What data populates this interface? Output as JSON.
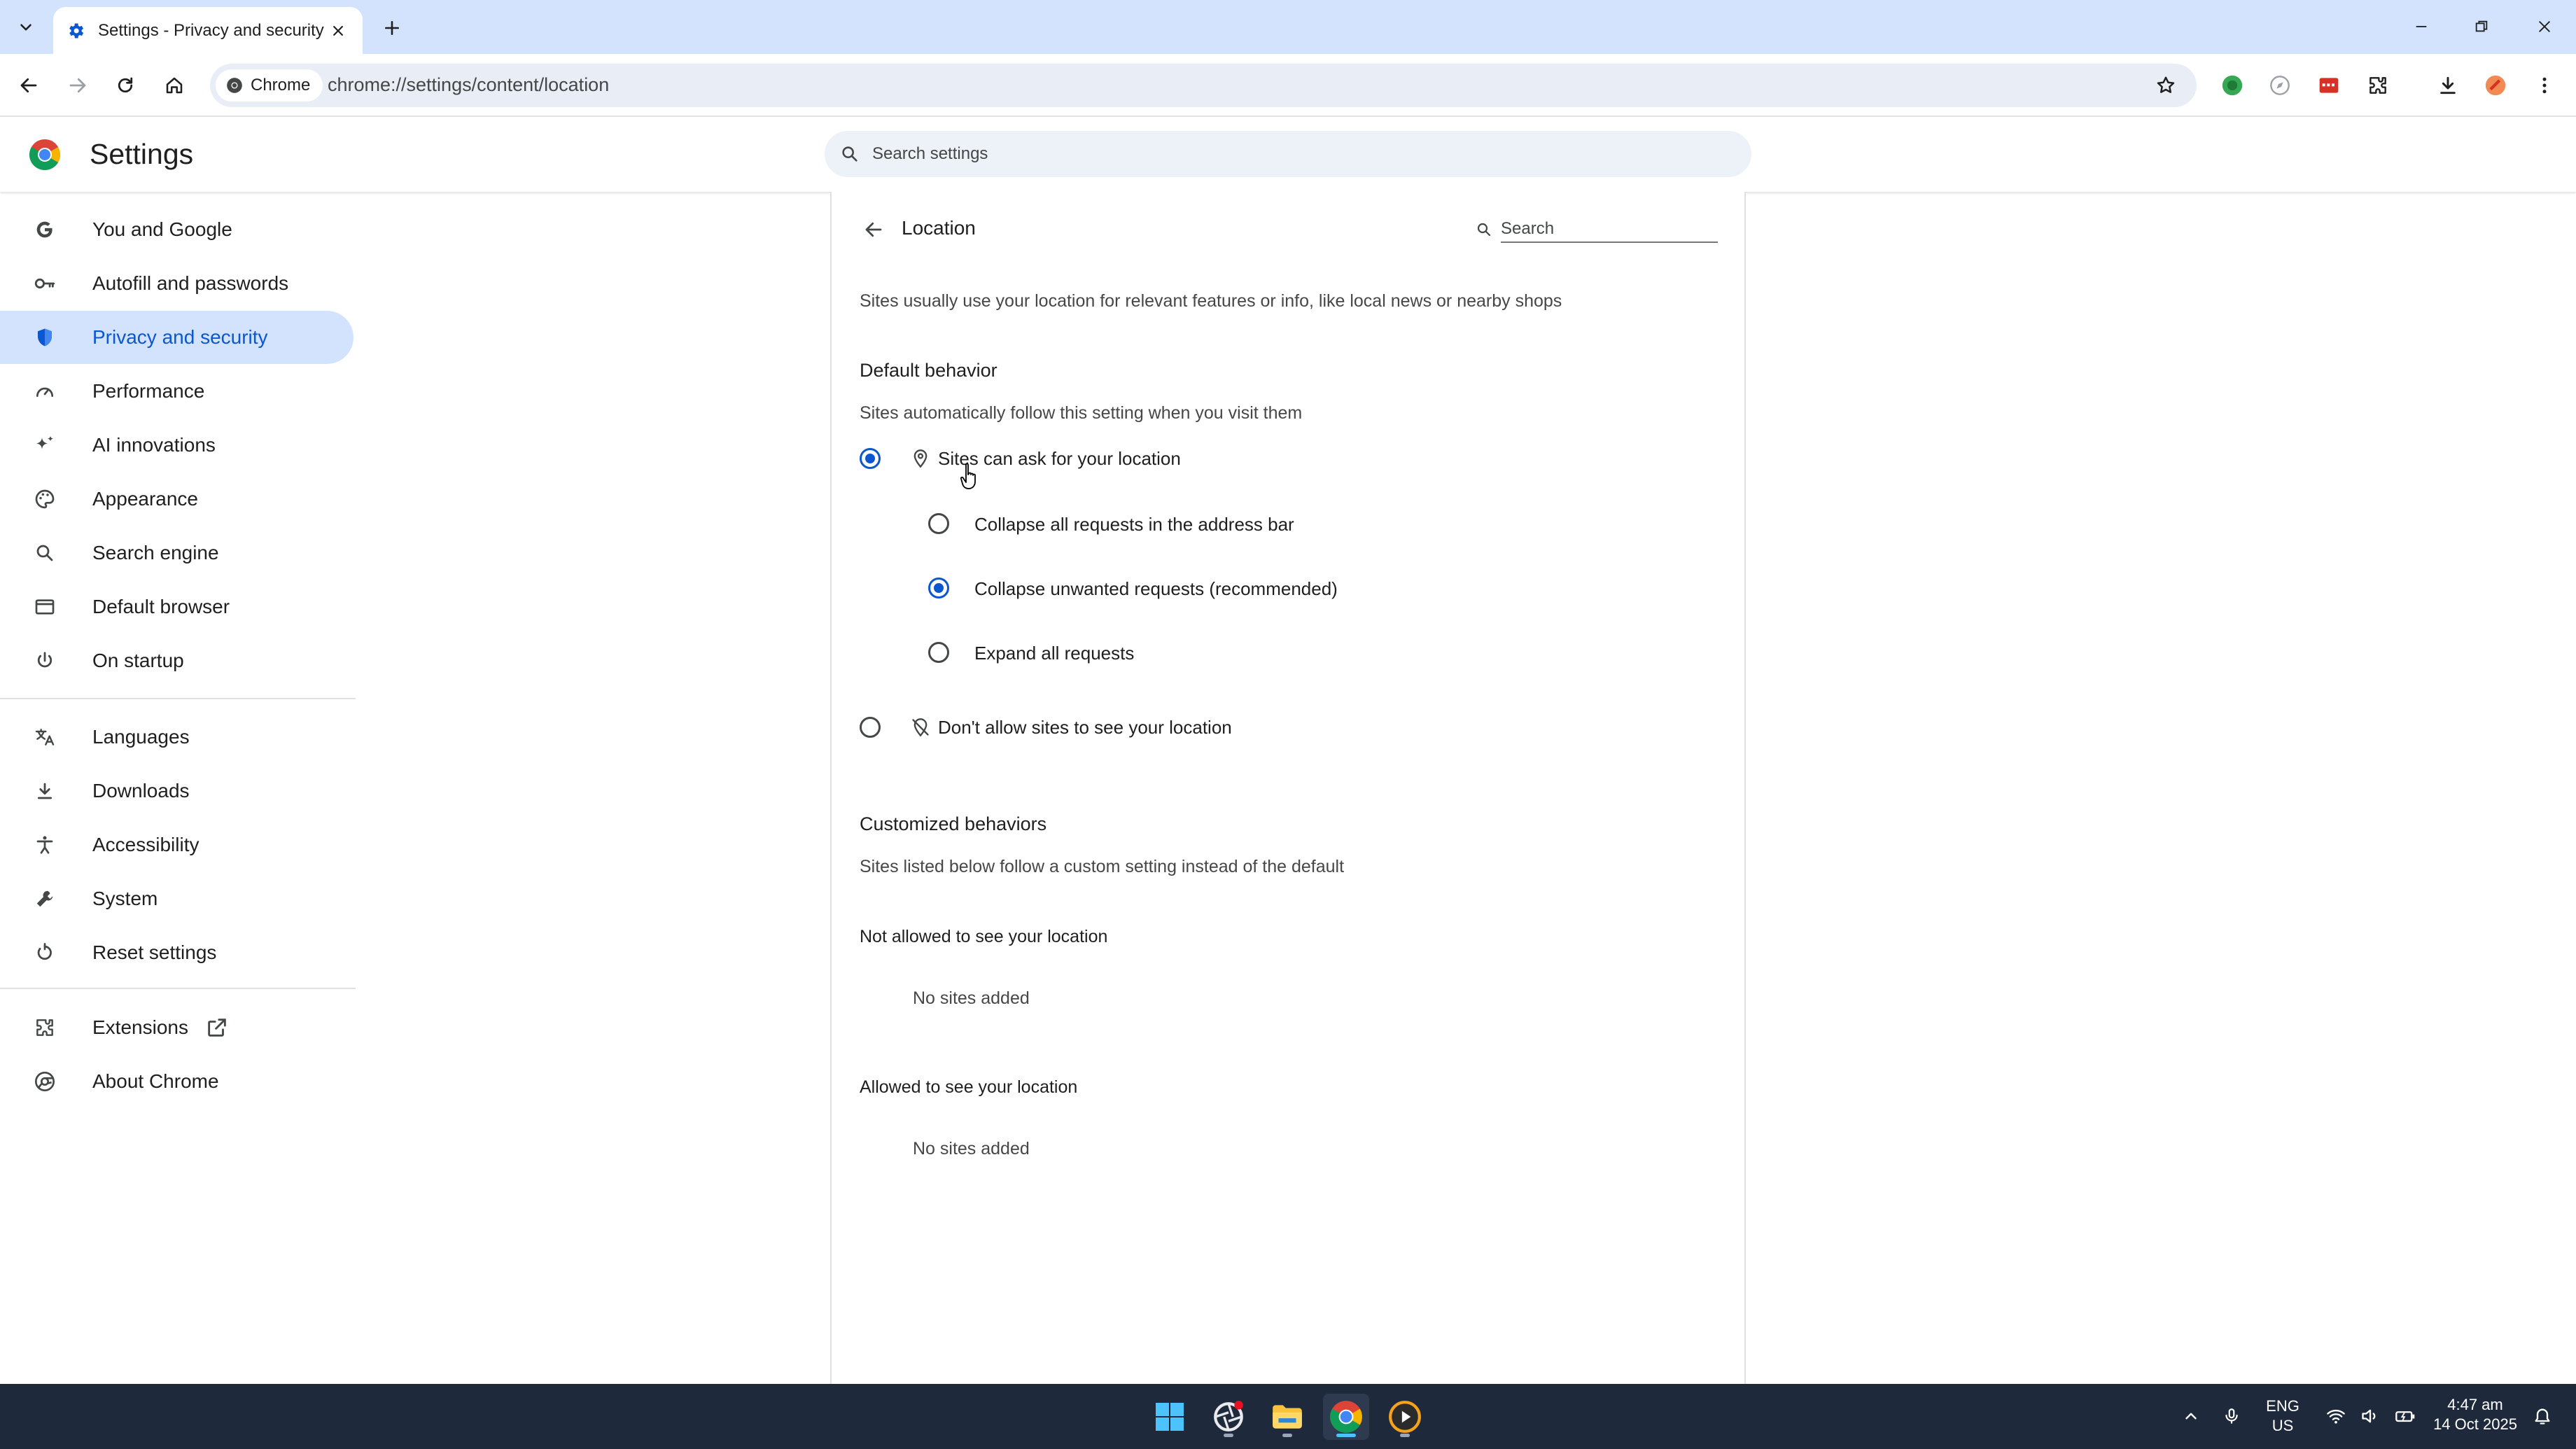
{
  "browser": {
    "tab_title": "Settings - Privacy and security",
    "site_chip": "Chrome",
    "url": "chrome://settings/content/location"
  },
  "settings": {
    "title": "Settings",
    "search_placeholder": "Search settings"
  },
  "sidebar": {
    "items": [
      {
        "label": "You and Google",
        "icon": "google-g-icon"
      },
      {
        "label": "Autofill and passwords",
        "icon": "key-icon"
      },
      {
        "label": "Privacy and security",
        "icon": "shield-icon",
        "active": true
      },
      {
        "label": "Performance",
        "icon": "speedometer-icon"
      },
      {
        "label": "AI innovations",
        "icon": "sparkle-icon"
      },
      {
        "label": "Appearance",
        "icon": "palette-icon"
      },
      {
        "label": "Search engine",
        "icon": "search-icon"
      },
      {
        "label": "Default browser",
        "icon": "browser-window-icon"
      },
      {
        "label": "On startup",
        "icon": "power-icon"
      },
      {
        "label": "Languages",
        "icon": "translate-icon"
      },
      {
        "label": "Downloads",
        "icon": "download-icon"
      },
      {
        "label": "Accessibility",
        "icon": "accessibility-icon"
      },
      {
        "label": "System",
        "icon": "wrench-icon"
      },
      {
        "label": "Reset settings",
        "icon": "reset-icon"
      },
      {
        "label": "Extensions",
        "icon": "puzzle-icon"
      },
      {
        "label": "About Chrome",
        "icon": "chrome-icon"
      }
    ]
  },
  "location": {
    "title": "Location",
    "search_placeholder": "Search",
    "intro": "Sites usually use your location for relevant features or info, like local news or nearby shops",
    "default_behavior": {
      "heading": "Default behavior",
      "description": "Sites automatically follow this setting when you visit them",
      "options": [
        {
          "label": "Sites can ask for your location",
          "selected": true
        },
        {
          "label": "Don't allow sites to see your location",
          "selected": false
        }
      ],
      "sub_options": [
        {
          "label": "Collapse all requests in the address bar",
          "selected": false
        },
        {
          "label": "Collapse unwanted requests (recommended)",
          "selected": true
        },
        {
          "label": "Expand all requests",
          "selected": false
        }
      ]
    },
    "customized": {
      "heading": "Customized behaviors",
      "description": "Sites listed below follow a custom setting instead of the default",
      "not_allowed_heading": "Not allowed to see your location",
      "not_allowed_empty": "No sites added",
      "allowed_heading": "Allowed to see your location",
      "allowed_empty": "No sites added"
    }
  },
  "taskbar": {
    "language_line1": "ENG",
    "language_line2": "US",
    "time": "4:47 am",
    "date": "14 Oct 2025"
  },
  "colors": {
    "accent": "#0b57d0",
    "active_nav_bg": "#d3e3fd",
    "tabstrip_bg": "#d3e3fd",
    "taskbar_bg": "#1e2a3c"
  }
}
